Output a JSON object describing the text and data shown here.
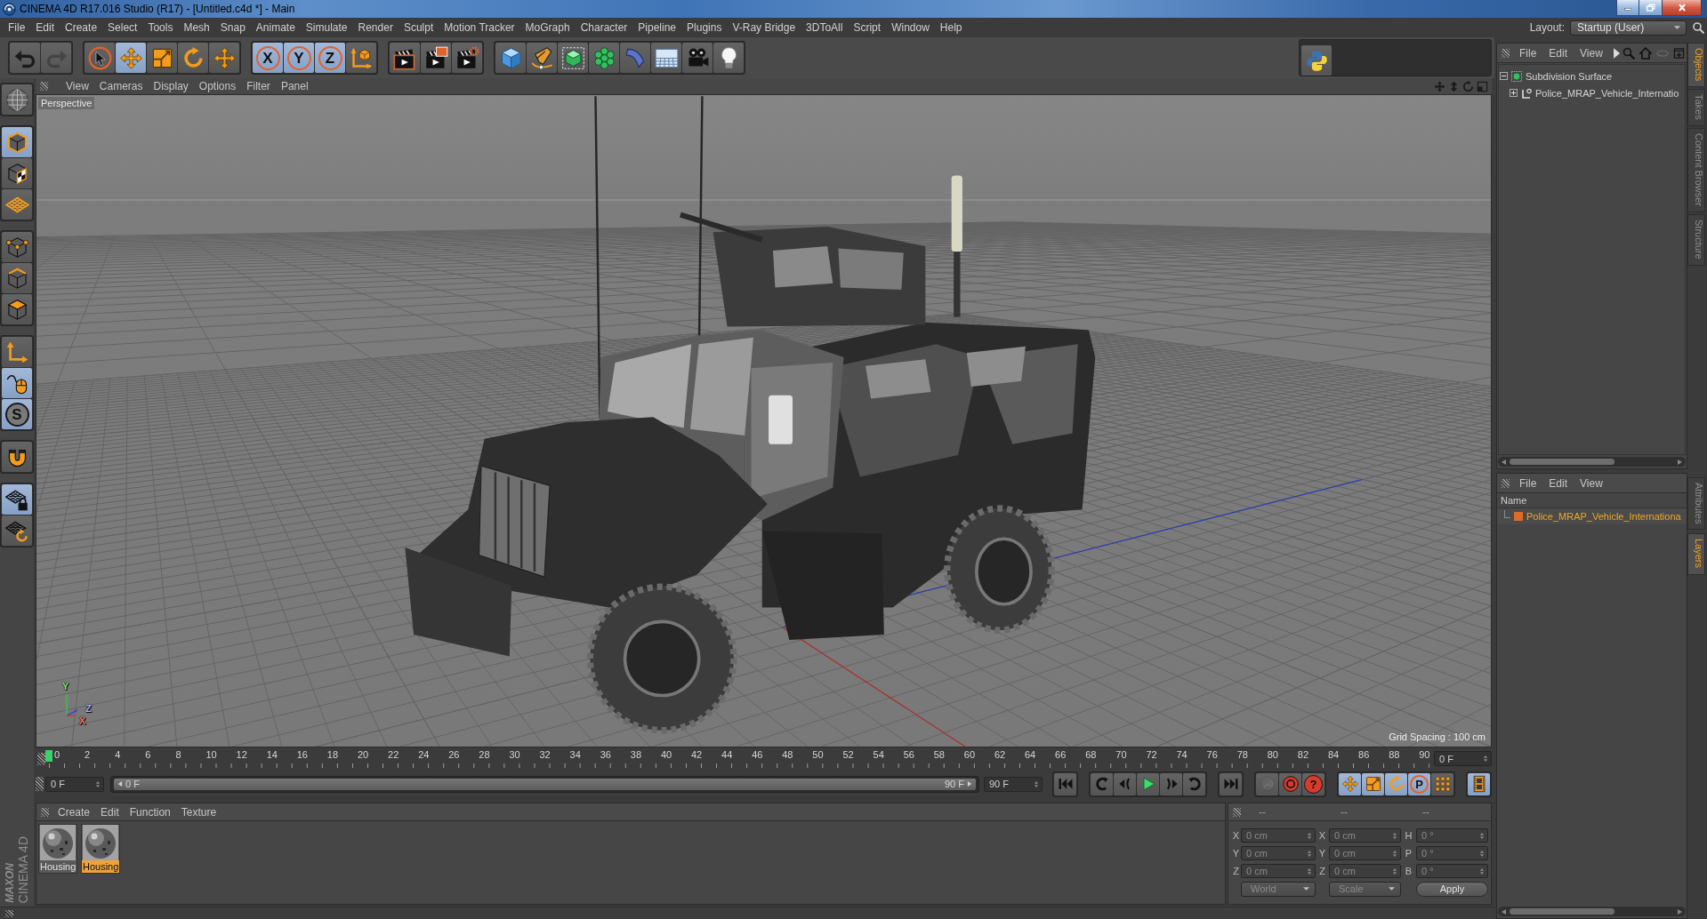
{
  "window": {
    "title": "CINEMA 4D R17.016 Studio (R17) - [Untitled.c4d *] - Main"
  },
  "menu_bar": {
    "items": [
      "File",
      "Edit",
      "Create",
      "Select",
      "Tools",
      "Mesh",
      "Snap",
      "Animate",
      "Simulate",
      "Render",
      "Sculpt",
      "Motion Tracker",
      "MoGraph",
      "Character",
      "Pipeline",
      "Plugins",
      "V-Ray Bridge",
      "3DToAll",
      "Script",
      "Window",
      "Help"
    ],
    "layout_label": "Layout:",
    "layout_value": "Startup (User)"
  },
  "toolbar": {
    "groups": [
      [
        {
          "kind": "undo",
          "selected": false,
          "disabled": false
        },
        {
          "kind": "redo",
          "selected": false,
          "disabled": true
        }
      ],
      [
        {
          "kind": "select",
          "selected": false,
          "disabled": false
        },
        {
          "kind": "move",
          "selected": true,
          "disabled": false
        },
        {
          "kind": "scale",
          "selected": false,
          "disabled": false
        },
        {
          "kind": "rotate",
          "selected": false,
          "disabled": false
        },
        {
          "kind": "recent",
          "selected": false,
          "disabled": false
        }
      ],
      [
        {
          "kind": "axis",
          "label": "X",
          "selected": true,
          "disabled": false
        },
        {
          "kind": "axis",
          "label": "Y",
          "selected": true,
          "disabled": false
        },
        {
          "kind": "axis",
          "label": "Z",
          "selected": true,
          "disabled": false
        },
        {
          "kind": "coords",
          "selected": false,
          "disabled": false
        }
      ],
      [
        {
          "kind": "renderview",
          "selected": false,
          "disabled": false
        },
        {
          "kind": "renderviewer",
          "selected": false,
          "disabled": false
        },
        {
          "kind": "rendersettings",
          "selected": false,
          "disabled": false
        }
      ],
      [
        {
          "kind": "cube",
          "selected": false,
          "disabled": false
        },
        {
          "kind": "pen",
          "selected": false,
          "disabled": false
        },
        {
          "kind": "subdivision",
          "selected": false,
          "disabled": false
        },
        {
          "kind": "cloner",
          "selected": false,
          "disabled": false
        },
        {
          "kind": "bend",
          "selected": false,
          "disabled": false
        },
        {
          "kind": "floor",
          "selected": false,
          "disabled": false
        },
        {
          "kind": "camera",
          "selected": false,
          "disabled": false
        },
        {
          "kind": "light",
          "selected": false,
          "disabled": false
        }
      ]
    ],
    "right_groups": [
      [
        {
          "kind": "python",
          "selected": false,
          "disabled": false
        }
      ]
    ]
  },
  "left_toolbar": {
    "groups": [
      [
        {
          "kind": "workplane",
          "selected": false
        }
      ],
      [
        {
          "kind": "model",
          "selected": true
        },
        {
          "kind": "texture",
          "selected": false
        },
        {
          "kind": "gridplane",
          "selected": false
        }
      ],
      [
        {
          "kind": "points",
          "selected": false
        },
        {
          "kind": "edges",
          "selected": false
        },
        {
          "kind": "polygons",
          "selected": false
        }
      ],
      [
        {
          "kind": "axismode",
          "selected": false
        },
        {
          "kind": "tweak",
          "selected": true
        },
        {
          "kind": "snap",
          "label": "S",
          "selected": true
        }
      ],
      [
        {
          "kind": "magnet",
          "selected": false
        }
      ],
      [
        {
          "kind": "gridlock",
          "selected": true
        },
        {
          "kind": "gridrotate",
          "selected": false
        }
      ]
    ]
  },
  "viewport": {
    "menu": [
      "View",
      "Cameras",
      "Display",
      "Options",
      "Filter",
      "Panel"
    ],
    "view_name": "Perspective",
    "axis_labels": [
      {
        "label": "Y",
        "color": "#7cf06c"
      },
      {
        "label": "Z",
        "color": "#a8b0ff"
      },
      {
        "label": "X",
        "color": "#ff6a6a"
      }
    ],
    "grid_spacing": "Grid Spacing : 100 cm"
  },
  "timeline": {
    "frames": [
      "0",
      "2",
      "4",
      "6",
      "8",
      "10",
      "12",
      "14",
      "16",
      "18",
      "20",
      "22",
      "24",
      "26",
      "28",
      "30",
      "32",
      "34",
      "36",
      "38",
      "40",
      "42",
      "44",
      "46",
      "48",
      "50",
      "52",
      "54",
      "56",
      "58",
      "60",
      "62",
      "64",
      "66",
      "68",
      "70",
      "72",
      "74",
      "76",
      "78",
      "80",
      "82",
      "84",
      "86",
      "88",
      "90"
    ],
    "playhead": {
      "level": 0
    },
    "current_frame": "0 F"
  },
  "time_slider": {
    "start_field": "0 F",
    "range_start": "0 F",
    "range_end": "90 F",
    "level": 1,
    "end_field": "90 F"
  },
  "transport": {
    "groups": [
      [
        {
          "kind": "start",
          "selected": false,
          "disabled": false
        }
      ],
      [
        {
          "kind": "prevkey",
          "selected": false,
          "disabled": false
        },
        {
          "kind": "prevframe",
          "selected": false,
          "disabled": false
        },
        {
          "kind": "play",
          "selected": false,
          "disabled": false
        },
        {
          "kind": "nextframe",
          "selected": false,
          "disabled": false
        },
        {
          "kind": "nextkey",
          "selected": false,
          "disabled": false
        }
      ],
      [
        {
          "kind": "end",
          "selected": false,
          "disabled": false
        }
      ],
      [
        {
          "kind": "record",
          "selected": false,
          "disabled": true
        },
        {
          "kind": "autokey",
          "selected": false,
          "disabled": false
        },
        {
          "kind": "help",
          "label": "?",
          "selected": false,
          "disabled": false
        }
      ],
      [
        {
          "kind": "poskey",
          "selected": true,
          "disabled": false
        },
        {
          "kind": "scalekey",
          "selected": true,
          "disabled": false
        },
        {
          "kind": "rotkey",
          "selected": true,
          "disabled": false
        },
        {
          "kind": "paramkey",
          "label": "P",
          "selected": true,
          "disabled": false
        },
        {
          "kind": "pointkey",
          "selected": false,
          "disabled": false
        }
      ],
      [
        {
          "kind": "timeline",
          "selected": true,
          "disabled": false
        }
      ]
    ]
  },
  "material_manager": {
    "menu": [
      "Create",
      "Edit",
      "Function",
      "Texture"
    ],
    "materials": [
      {
        "name": "Housing",
        "selected": false
      },
      {
        "name": "Housing",
        "selected": true
      }
    ]
  },
  "coordinates": {
    "headers": [
      "--",
      "--",
      "--"
    ],
    "rows": [
      [
        {
          "axis": "X",
          "value": "0 cm"
        },
        {
          "axis": "X",
          "value": "0 cm"
        },
        {
          "axis": "H",
          "value": "0 °"
        }
      ],
      [
        {
          "axis": "Y",
          "value": "0 cm"
        },
        {
          "axis": "Y",
          "value": "0 cm"
        },
        {
          "axis": "P",
          "value": "0 °"
        }
      ],
      [
        {
          "axis": "Z",
          "value": "0 cm"
        },
        {
          "axis": "Z",
          "value": "0 cm"
        },
        {
          "axis": "B",
          "value": "0 °"
        }
      ]
    ],
    "modes": [
      "World",
      "Scale"
    ],
    "apply": "Apply"
  },
  "object_manager": {
    "menu": [
      "File",
      "Edit",
      "View"
    ],
    "tree": [
      {
        "name": "Subdivision Surface",
        "kind": "subdivision",
        "expanded": true,
        "children": [
          {
            "name": "Police_MRAP_Vehicle_Internatio",
            "kind": "null",
            "expanded": false
          }
        ]
      }
    ]
  },
  "layer_manager": {
    "menu": [
      "File",
      "Edit",
      "View"
    ],
    "column": "Name",
    "layers": [
      {
        "name": "Police_MRAP_Vehicle_Internationa",
        "color": "#e06a2a",
        "selected": true
      }
    ]
  },
  "side_tabs": {
    "top": [
      {
        "label": "Objects",
        "selected": true
      },
      {
        "label": "Takes",
        "selected": false
      },
      {
        "label": "Content Browser",
        "selected": false
      },
      {
        "label": "Structure",
        "selected": false
      }
    ],
    "bottom": [
      {
        "label": "Attributes",
        "selected": false
      },
      {
        "label": "Layers",
        "selected": true
      }
    ]
  },
  "logo": {
    "brand": "MAXON",
    "product": "CINEMA 4D"
  }
}
